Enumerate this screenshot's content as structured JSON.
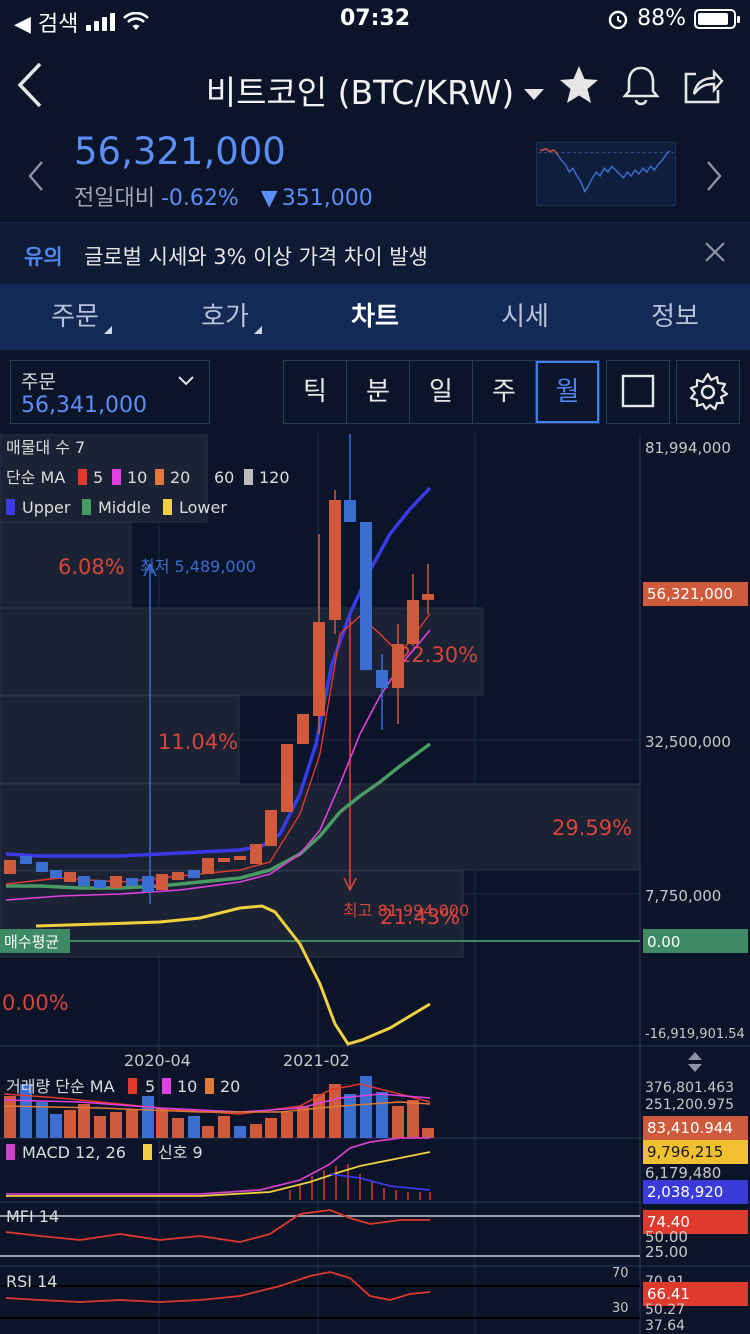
{
  "status_bar": {
    "back_app": "◀ 검색",
    "time": "07:32",
    "battery": "88%",
    "battery_level": 0.88
  },
  "header": {
    "title": "비트코인 (BTC/KRW)",
    "icons": [
      "back-chevron-icon",
      "star-icon",
      "bell-icon",
      "share-icon"
    ]
  },
  "price": {
    "current": "56,321,000",
    "compare_label": "전일대비",
    "change_pct": "-0.62%",
    "change_arrow": "▼",
    "change_amount": "351,000"
  },
  "notice": {
    "tag": "유의",
    "message": "글로벌 시세와 3% 이상 가격 차이 발생"
  },
  "tabs": [
    {
      "label": "주문",
      "has_menu": true
    },
    {
      "label": "호가",
      "has_menu": true
    },
    {
      "label": "차트",
      "active": true
    },
    {
      "label": "시세"
    },
    {
      "label": "정보"
    }
  ],
  "order_select": {
    "label": "주문",
    "value": "56,341,000"
  },
  "periods": [
    {
      "label": "틱"
    },
    {
      "label": "분"
    },
    {
      "label": "일"
    },
    {
      "label": "주"
    },
    {
      "label": "월",
      "active": true
    }
  ],
  "legend": {
    "line1": "매물대 수 7",
    "ma_label": "단순 MA",
    "ma_items": [
      {
        "label": "5",
        "color": "#e03a2e"
      },
      {
        "label": "10",
        "color": "#e040e0"
      },
      {
        "label": "20",
        "color": "#e07a3a"
      },
      {
        "label": "60",
        "color": "#888888"
      },
      {
        "label": "120",
        "color": "#bbbbbb"
      }
    ],
    "band_items": [
      {
        "label": "Upper",
        "color": "#3a3ae8"
      },
      {
        "label": "Middle",
        "color": "#4a9a64"
      },
      {
        "label": "Lower",
        "color": "#f0d040"
      }
    ]
  },
  "main_chart": {
    "y_labels": [
      "81,994,000",
      "32,500,000",
      "7,750,000",
      "-16,919,901.54"
    ],
    "current_price_tag": "56,321,000",
    "avg_price_tag": "0.00",
    "avg_label": "매수평균",
    "volume_profile_pcts": [
      "6.08%",
      "22.30%",
      "11.04%",
      "29.59%",
      "21.43%",
      "0.00%"
    ],
    "low_annotation": "최저 5,489,000",
    "high_annotation": "최고 81,994,000",
    "x_labels": [
      "2020-04",
      "2021-02"
    ]
  },
  "volume_panel": {
    "label": "거래량 단순 MA",
    "ma_items": [
      {
        "label": "5",
        "color": "#e03a2e"
      },
      {
        "label": "10",
        "color": "#e040e0"
      },
      {
        "label": "20",
        "color": "#e07a3a"
      }
    ],
    "y_labels": [
      "376,801.463",
      "251,200.975"
    ],
    "tag": "83,410.944"
  },
  "macd_panel": {
    "label": "MACD 12, 26",
    "signal_label": "신호 9",
    "y_label": "6,179,480",
    "tag_signal": "9,796,215",
    "tag_macd": "2,038,920"
  },
  "mfi_panel": {
    "label": "MFI 14",
    "y_labels": [
      "50.00",
      "25.00"
    ],
    "tag": "74.40"
  },
  "rsi_panel": {
    "label": "RSI 14",
    "y_labels": [
      "70",
      "30",
      "70.91",
      "50.27",
      "37.64"
    ],
    "tag": "66.41"
  },
  "colors": {
    "up": "#d05a3c",
    "down": "#3a6ed0",
    "accent": "#5b8ef7",
    "background": "#0b1428",
    "tab_bar": "#132a57"
  }
}
